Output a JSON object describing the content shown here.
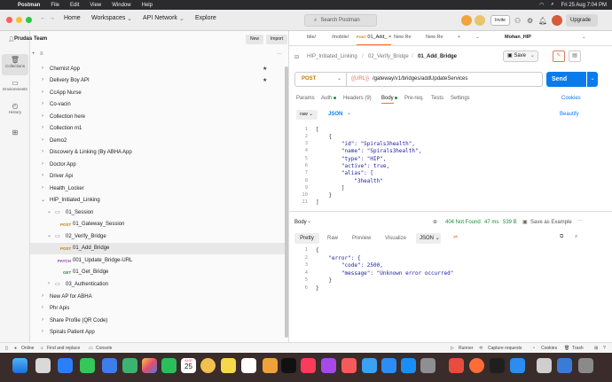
{
  "menubar": {
    "app": "Postman",
    "items": [
      "File",
      "Edit",
      "View",
      "Window",
      "Help"
    ],
    "datetime": "Fri 25 Aug  7:04 PM"
  },
  "header": {
    "home": "Home",
    "workspaces": "Workspaces",
    "api_network": "API Network",
    "explore": "Explore",
    "search": "Search Postman",
    "invite": "Invite",
    "upgrade": "Upgrade"
  },
  "sidebar": {
    "team": "Prudas Team",
    "new": "New",
    "import": "Import",
    "rail": [
      "Collections",
      "Environments",
      "History"
    ],
    "collections": [
      "Chemist App",
      "Delivery Boy API",
      "CcApp Nurse",
      "Co-vacin",
      "Collection here",
      "Collection m1",
      "Demo2",
      "Discovery & Linking (By ABHA App",
      "Doctor App",
      "Driver Api",
      "Health_Locker",
      "HIP_Initiated_Linking"
    ],
    "folder1": "01_Session",
    "req1_method": "POST",
    "req1": "01_Gateway_Session",
    "folder2": "02_Verify_Bridge",
    "req2_method": "POST",
    "req2": "01_Add_Bridge",
    "req3_method": "PATCH",
    "req3": "001_Update_Bridge-URL",
    "req4_method": "GET",
    "req4": "01_Get_Bridge",
    "folder3": "03_Authentication",
    "more": [
      "New AP for ABHA",
      "Phr Apis",
      "Share Profile (QR Code)",
      "Spirals Patient App"
    ]
  },
  "tabs": [
    "bile/",
    "/mobile/",
    "01_Add_",
    "New Re",
    "New Re"
  ],
  "env": "Mohan_HIP",
  "breadcrumb": {
    "a": "HIP_Initiated_Linking",
    "b": "02_Verify_Bridge",
    "c": "01_Add_Bridge"
  },
  "save": "Save",
  "request": {
    "method": "POST",
    "url_var": "{{URL}}",
    "url_rest": "/gateway/v1/bridges/addUpdateServices",
    "send": "Send"
  },
  "req_tabs": {
    "params": "Params",
    "auth": "Auth",
    "headers": "Headers (9)",
    "body": "Body",
    "prereq": "Pre-req.",
    "tests": "Tests",
    "settings": "Settings",
    "cookies": "Cookies"
  },
  "body_opts": {
    "raw": "raw",
    "json": "JSON",
    "beautify": "Beautify"
  },
  "request_body": [
    "[",
    "    {",
    "        \"id\": \"Spirals3health\",",
    "        \"name\": \"Spirals3health\",",
    "        \"type\": \"HIP\",",
    "        \"active\": true,",
    "        \"alias\": [",
    "            \"3health\"",
    "        ]",
    "    }",
    "]"
  ],
  "response": {
    "label": "Body",
    "status": "404 Not Found",
    "time": "47 ms",
    "size": "539 B",
    "save_example": "Save as Example",
    "tabs": [
      "Pretty",
      "Raw",
      "Preview",
      "Visualize"
    ],
    "format": "JSON",
    "body": [
      "{",
      "    \"error\": {",
      "        \"code\": 2500,",
      "        \"message\": \"Unknown error occurred\"",
      "    }",
      "}"
    ]
  },
  "statusbar": {
    "online": "Online",
    "find": "Find and replace",
    "console": "Console",
    "runner": "Runner",
    "capture": "Capture requests",
    "cookies": "Cookies",
    "trash": "Trash"
  },
  "dock": {
    "date_month": "AUG",
    "date_day": "25"
  }
}
